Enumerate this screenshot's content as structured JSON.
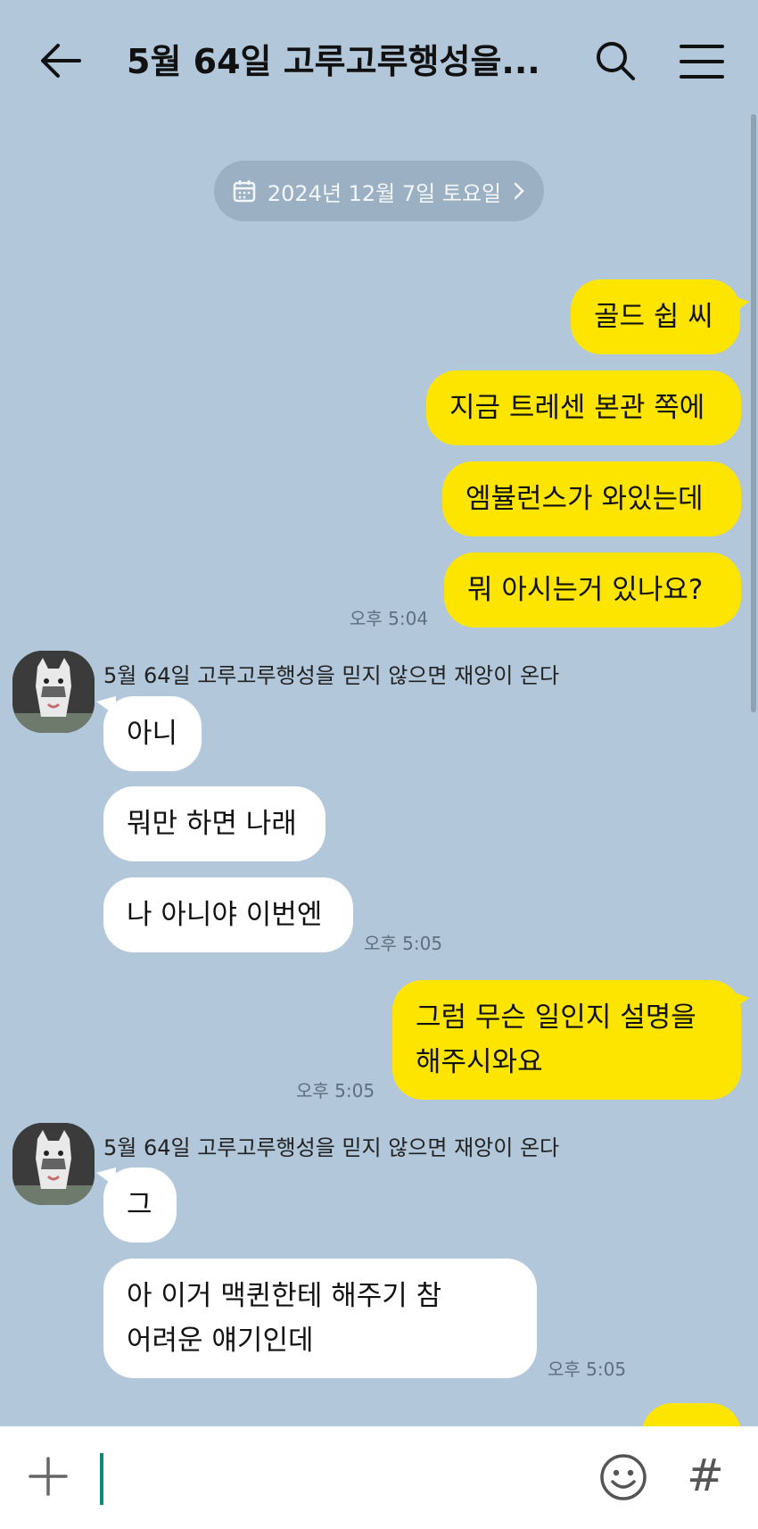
{
  "header": {
    "title": "5월 64일 고루고루행성을..."
  },
  "date_divider": {
    "label": "2024년 12월 7일 토요일"
  },
  "messages": [
    {
      "sender": "me",
      "text": "골드 쉽 씨"
    },
    {
      "sender": "me",
      "text": "지금 트레센 본관 쪽에"
    },
    {
      "sender": "me",
      "text": "엠뷸런스가 와있는데"
    },
    {
      "sender": "me",
      "text": "뭐 아시는거 있나요?",
      "time": "오후 5:04"
    },
    {
      "sender": "them",
      "name": "5월 64일 고루고루행성을 믿지 않으면 재앙이 온다",
      "text": "아니"
    },
    {
      "sender": "them",
      "text": "뭐만 하면 나래"
    },
    {
      "sender": "them",
      "text": "나 아니야 이번엔",
      "time": "오후 5:05"
    },
    {
      "sender": "me",
      "text_lines": [
        "그럼 무슨 일인지 설명을",
        "해주시와요"
      ],
      "time": "오후 5:05"
    },
    {
      "sender": "them",
      "name": "5월 64일 고루고루행성을 믿지 않으면 재앙이 온다",
      "text": "그"
    },
    {
      "sender": "them",
      "text_lines": [
        "아 이거 맥퀸한테 해주기 참",
        "어려운 얘기인데"
      ],
      "time": "오후 5:05"
    }
  ],
  "input_bar": {
    "value": "",
    "plus_icon": "plus-icon",
    "emoji_icon": "emoji-icon",
    "hash_label": "#"
  },
  "colors": {
    "background": "#b2c7da",
    "my_bubble": "#fee500",
    "their_bubble": "#ffffff",
    "date_pill": "#9bb0c3"
  }
}
